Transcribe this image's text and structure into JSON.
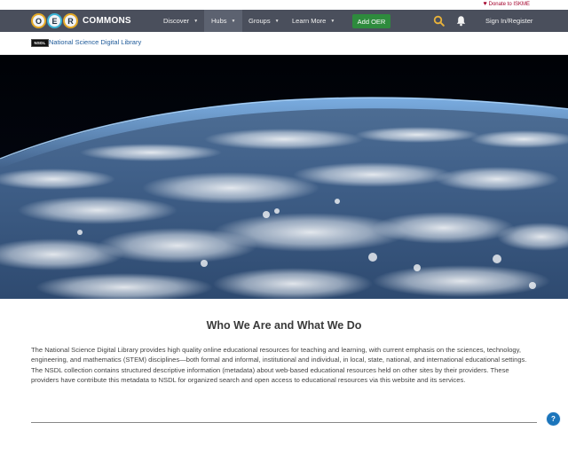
{
  "top": {
    "donate_label": "Donate to ISKME"
  },
  "nav": {
    "brand": "COMMONS",
    "logo_letters": [
      "O",
      "E",
      "R"
    ],
    "items": [
      {
        "label": "Discover"
      },
      {
        "label": "Hubs"
      },
      {
        "label": "Groups"
      },
      {
        "label": "Learn More"
      }
    ],
    "add_oer": "Add OER",
    "sign_in": "Sign In/Register"
  },
  "hub": {
    "badge": "NSDL",
    "name": "National Science Digital Library"
  },
  "content": {
    "heading": "Who We Are and What We Do",
    "description": "The National Science Digital Library provides high quality online educational resources for teaching and learning, with current emphasis on the sciences, technology, engineering, and mathematics (STEM) disciplines—both formal and informal, institutional and individual, in local, state, national, and international educational settings. The NSDL collection contains structured descriptive information (metadata) about web-based educational resources held on other sites by their providers. These providers have contribute this metadata to NSDL for organized search and open access to educational resources via this website and its services."
  },
  "help_label": "?",
  "icons": {
    "heart": "heart-icon",
    "search": "search-icon",
    "bell": "bell-icon",
    "help": "help-icon",
    "caret": "chevron-down-icon"
  },
  "colors": {
    "navbar": "#4a4f5c",
    "accent_green": "#2e8b3d",
    "link_blue": "#1e5a99",
    "help_blue": "#1b75bb",
    "search_yellow": "#e8b23a"
  }
}
